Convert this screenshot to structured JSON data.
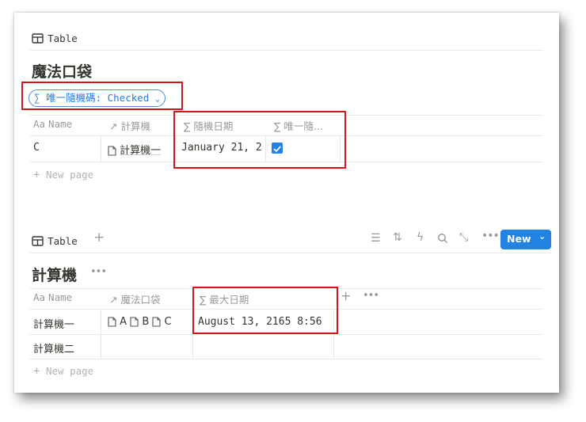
{
  "top": {
    "view_label": "Table",
    "title": "魔法口袋",
    "filter_chip": "唯一隨機碼: Checked",
    "columns": [
      "Name",
      "計算機",
      "隨機日期",
      "唯一隨…"
    ],
    "name_col_prefix": "Aa",
    "rows": [
      {
        "name": "C",
        "calc": "計算機一",
        "date": "January 21, 2",
        "checked": true
      }
    ],
    "new_page": "New page"
  },
  "bottom": {
    "view_label": "Table",
    "title": "計算機",
    "new_button": "New",
    "columns": [
      "Name",
      "魔法口袋",
      "最大日期"
    ],
    "name_col_prefix": "Aa",
    "rows": [
      {
        "name": "計算機一",
        "rel": [
          "A",
          "B",
          "C"
        ],
        "max_date": "August 13, 2165 8:56"
      },
      {
        "name": "計算機二",
        "rel": [],
        "max_date": ""
      }
    ],
    "new_page": "New page"
  },
  "colors": {
    "accent": "#2383e2",
    "highlight": "#d6151b",
    "chip_text": "#2b7bd6"
  }
}
